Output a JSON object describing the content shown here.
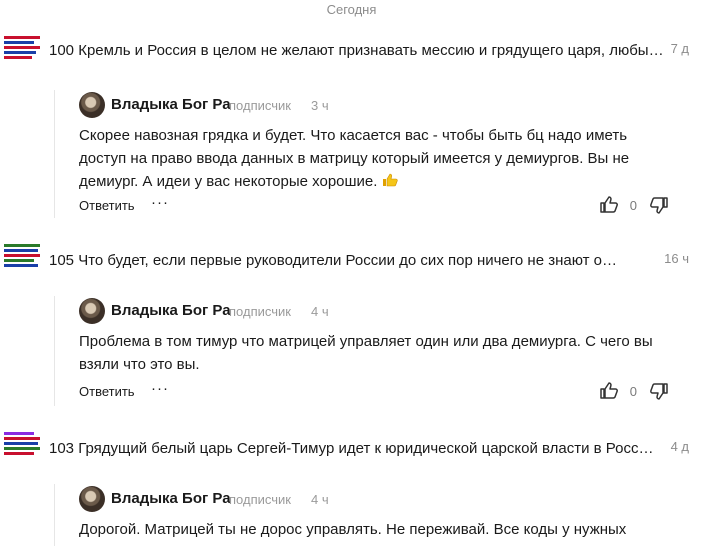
{
  "date_separator": "Сегодня",
  "threads": [
    {
      "post_number": "100",
      "post_title": "Кремль и Россия в целом не желают признавать мессию и грядущего царя, любые…",
      "post_age": "7 д",
      "thumb_colors": [
        "#c8102e",
        "#1a3fa8",
        "#c8102e",
        "#1a3fa8",
        "#c8102e"
      ],
      "reply": {
        "author": "Владыка Бог Ра",
        "subscriber": "подписчик",
        "age": "3 ч",
        "lines": [
          "Скорее навозная грядка и будет. Что касается вас - чтобы быть бц надо иметь",
          "доступ на право ввода данных в матрицу который имеется у демиургов. Вы не",
          "демиург. А идеи у вас некоторые хорошие."
        ],
        "reply_label": "Ответить",
        "more_label": "···",
        "like_count": "0"
      }
    },
    {
      "post_number": "105",
      "post_title": "Что будет, если первые руководители России до сих пор ничего не знают о…",
      "post_age": "16 ч",
      "thumb_colors": [
        "#2a7a2a",
        "#1a3fa8",
        "#c8102e",
        "#2a7a2a",
        "#1a3fa8"
      ],
      "reply": {
        "author": "Владыка Бог Ра",
        "subscriber": "подписчик",
        "age": "4 ч",
        "lines": [
          "Проблема в том тимур что матрицей управляет один или два демиурга. С чего вы",
          "взяли что это вы."
        ],
        "reply_label": "Ответить",
        "more_label": "···",
        "like_count": "0"
      }
    },
    {
      "post_number": "103",
      "post_title": "Грядущий белый царь Сергей-Тимур идет к юридической царской власти в Росси…",
      "post_age": "4 д",
      "thumb_colors": [
        "#8a2be2",
        "#c8102e",
        "#1a3fa8",
        "#2a7a2a",
        "#c8102e"
      ],
      "reply": {
        "author": "Владыка Бог Ра",
        "subscriber": "подписчик",
        "age": "4 ч",
        "lines": [
          "Дорогой. Матрицей ты не дорос управлять. Не переживай. Все коды у нужных"
        ]
      }
    }
  ]
}
